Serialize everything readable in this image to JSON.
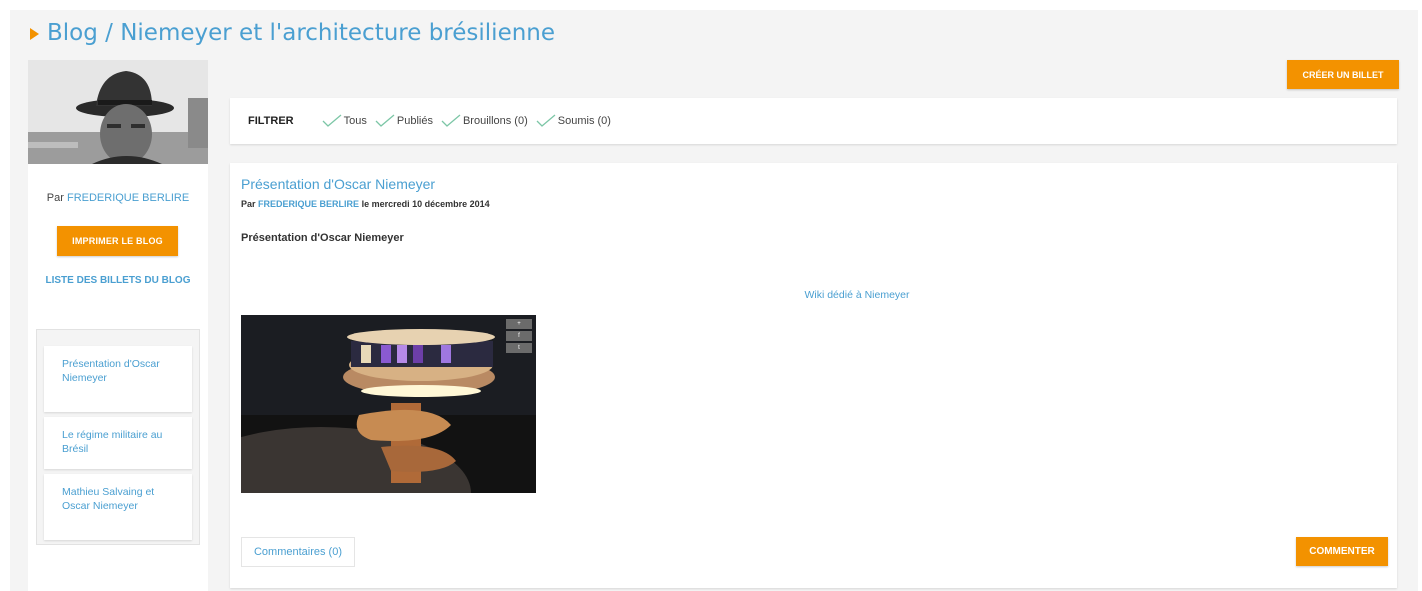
{
  "header": {
    "title": "Blog / Niemeyer et l'architecture brésilienne"
  },
  "sidebar": {
    "author_prefix": "Par",
    "author_name": "FREDERIQUE BERLIRE",
    "print_label": "IMPRIMER LE BLOG",
    "list_link": "LISTE DES BILLETS DU BLOG",
    "posts": [
      {
        "label": "Présentation d'Oscar Niemeyer"
      },
      {
        "label": "Le régime militaire au Brésil"
      },
      {
        "label": "Mathieu Salvaing et Oscar Niemeyer"
      }
    ]
  },
  "toolbar": {
    "create_label": "CRÉER UN BILLET"
  },
  "filter": {
    "label": "FILTRER",
    "options": [
      {
        "label": "Tous"
      },
      {
        "label": "Publiés"
      },
      {
        "label": "Brouillons (0)"
      },
      {
        "label": "Soumis (0)"
      }
    ]
  },
  "post": {
    "title": "Présentation d'Oscar Niemeyer",
    "meta_prefix": "Par",
    "meta_author": "FREDERIQUE BERLIRE",
    "meta_date": "le mercredi 10 décembre 2014",
    "subtitle": "Présentation d'Oscar Niemeyer",
    "wiki_link": "Wiki dédié à Niemeyer",
    "comments_label": "Commentaires (0)",
    "comment_label": "COMMENTER"
  },
  "colors": {
    "accent": "#f39200",
    "link": "#4a9fd1",
    "background": "#f4f4f4"
  },
  "icons": {
    "filter_option": "check-icon",
    "title": "triangle-right-icon"
  }
}
